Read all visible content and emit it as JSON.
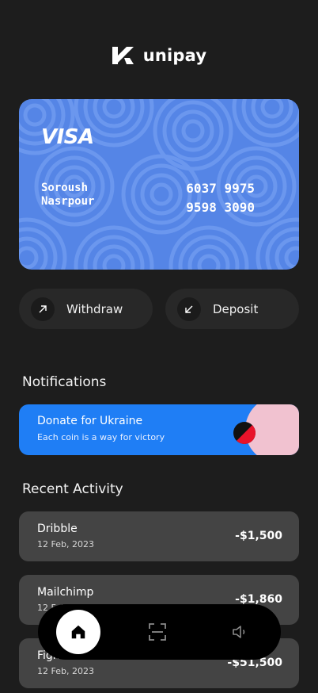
{
  "app": {
    "name": "unipay",
    "logo_icon": "unipay-logo-icon"
  },
  "card": {
    "brand": "VISA",
    "holder_first": "Soroush",
    "holder_last": "Nasrpour",
    "number_line1": "6037 9975",
    "number_line2": "9598 3090",
    "color": "#5585e6"
  },
  "actions": {
    "withdraw": {
      "label": "Withdraw",
      "icon": "arrow-up-right-icon"
    },
    "deposit": {
      "label": "Deposit",
      "icon": "arrow-down-left-icon"
    }
  },
  "notifications": {
    "title": "Notifications",
    "banner": {
      "title": "Donate for Ukraine",
      "subtitle": "Each coin is a way for victory",
      "color": "#1f7ef5",
      "accent": "#f1c2d0"
    }
  },
  "recent_activity": {
    "title": "Recent Activity",
    "items": [
      {
        "name": "Dribble",
        "date": "12 Feb, 2023",
        "amount": "-$1,500"
      },
      {
        "name": "Mailchimp",
        "date": "12 Feb, 2023",
        "amount": "-$1,860"
      },
      {
        "name": "Figma",
        "date": "12 Feb, 2023",
        "amount": "-$51,500"
      }
    ]
  },
  "nav": {
    "items": [
      {
        "name": "home",
        "icon": "home-icon",
        "active": true
      },
      {
        "name": "scan",
        "icon": "scan-icon",
        "active": false
      },
      {
        "name": "sound",
        "icon": "speaker-icon",
        "active": false
      }
    ]
  }
}
